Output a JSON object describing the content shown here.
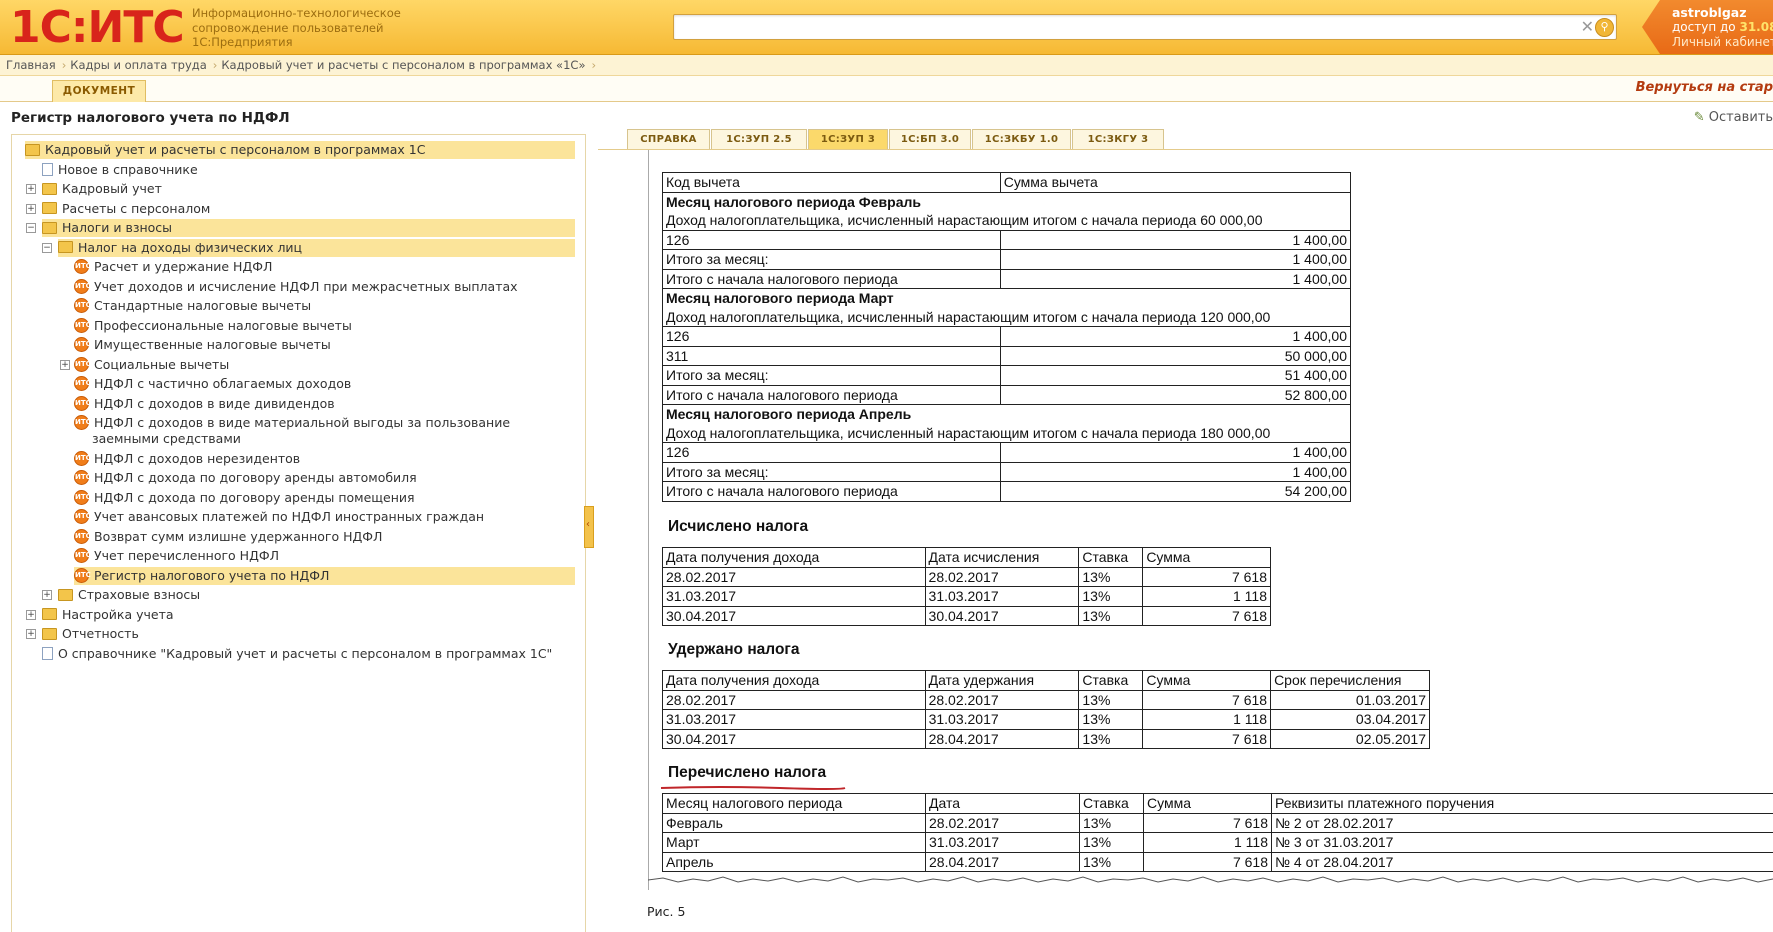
{
  "header": {
    "logo": "1С:ИТС",
    "subtitle_lines": [
      "Информационно-технологическое",
      "сопровождение пользователей",
      "1С:Предприятия"
    ],
    "search_value": "",
    "account_user": "astroblgaz",
    "account_access_prefix": "доступ до",
    "account_access_date": "31.08.",
    "account_cabinet": "Личный кабинет"
  },
  "breadcrumb": [
    "Главная",
    "Кадры и оплата труда",
    "Кадровый учет и расчеты с персоналом в программах «1С»"
  ],
  "doc_tab": "ДОКУМЕНТ",
  "back_link": "Вернуться на стар",
  "page_title": "Регистр налогового учета по НДФЛ",
  "leave_link": "Оставить",
  "tree": [
    {
      "label": "Кадровый учет и расчеты с персоналом в программах 1С",
      "icon": "folder-icon",
      "selected": true
    },
    {
      "label": "Новое в справочнике",
      "icon": "document-icon"
    },
    {
      "label": "Кадровый учет",
      "icon": "folder-icon",
      "toggle": "+"
    },
    {
      "label": "Расчеты с персоналом",
      "icon": "folder-icon",
      "toggle": "+"
    },
    {
      "label": "Налоги и взносы",
      "icon": "folder-icon",
      "toggle": "−",
      "selected": true
    },
    {
      "label": "Налог на доходы физических лиц",
      "icon": "folder-icon",
      "toggle": "−",
      "selected": true
    },
    {
      "label": "Расчет и удержание НДФЛ",
      "icon": "its-badge-icon"
    },
    {
      "label": "Учет доходов и исчисление НДФЛ при межрасчетных выплатах",
      "icon": "its-badge-icon"
    },
    {
      "label": "Стандартные налоговые вычеты",
      "icon": "its-badge-icon"
    },
    {
      "label": "Профессиональные налоговые вычеты",
      "icon": "its-badge-icon"
    },
    {
      "label": "Имущественные налоговые вычеты",
      "icon": "its-badge-icon"
    },
    {
      "label": "Социальные вычеты",
      "icon": "its-badge-icon",
      "toggle": "+"
    },
    {
      "label": "НДФЛ с частично облагаемых доходов",
      "icon": "its-badge-icon"
    },
    {
      "label": "НДФЛ с доходов в виде дивидендов",
      "icon": "its-badge-icon"
    },
    {
      "label": "НДФЛ с доходов в виде материальной выгоды за пользование",
      "label2": "заемными средствами",
      "icon": "its-badge-icon"
    },
    {
      "label": "НДФЛ с доходов нерезидентов",
      "icon": "its-badge-icon"
    },
    {
      "label": "НДФЛ с дохода по договору аренды автомобиля",
      "icon": "its-badge-icon"
    },
    {
      "label": "НДФЛ с дохода по договору аренды помещения",
      "icon": "its-badge-icon"
    },
    {
      "label": "Учет авансовых платежей по НДФЛ иностранных граждан",
      "icon": "its-badge-icon"
    },
    {
      "label": "Возврат сумм излишне удержанного НДФЛ",
      "icon": "its-badge-icon"
    },
    {
      "label": "Учет перечисленного НДФЛ",
      "icon": "its-badge-icon"
    },
    {
      "label": "Регистр налогового учета по НДФЛ",
      "icon": "its-badge-icon",
      "selected": true
    },
    {
      "label": "Страховые взносы",
      "icon": "folder-icon",
      "toggle": "+"
    },
    {
      "label": "Настройка учета",
      "icon": "folder-icon",
      "toggle": "+"
    },
    {
      "label": "Отчетность",
      "icon": "folder-icon",
      "toggle": "+"
    },
    {
      "label": "О справочнике \"Кадровый учет и расчеты с персоналом в программах 1С\"",
      "icon": "document-icon"
    }
  ],
  "tabs": [
    "СПРАВКА",
    "1С:ЗУП 2.5",
    "1С:ЗУП 3",
    "1С:БП 3.0",
    "1С:ЗКБУ 1.0",
    "1С:ЗКГУ 3"
  ],
  "active_tab": "1С:ЗУП 3",
  "deductions": {
    "header": [
      "Код вычета",
      "Сумма вычета"
    ],
    "months": [
      {
        "title": "Месяц налогового периода Февраль",
        "income": "Доход налогоплательщика, исчисленный нарастающим итогом с начала периода 60 000,00",
        "rows": [
          [
            "126",
            "1 400,00"
          ],
          [
            "Итого за месяц:",
            "1 400,00"
          ],
          [
            "Итого с начала налогового периода",
            "1 400,00"
          ]
        ]
      },
      {
        "title": "Месяц налогового периода Март",
        "income": "Доход налогоплательщика, исчисленный нарастающим итогом с начала периода 120 000,00",
        "rows": [
          [
            "126",
            "1 400,00"
          ],
          [
            "311",
            "50 000,00"
          ],
          [
            "Итого за месяц:",
            "51 400,00"
          ],
          [
            "Итого с начала налогового периода",
            "52 800,00"
          ]
        ]
      },
      {
        "title": "Месяц налогового периода Апрель",
        "income": "Доход налогоплательщика, исчисленный нарастающим итогом с начала периода 180 000,00",
        "rows": [
          [
            "126",
            "1 400,00"
          ],
          [
            "Итого за месяц:",
            "1 400,00"
          ],
          [
            "Итого с начала налогового периода",
            "54 200,00"
          ]
        ]
      }
    ]
  },
  "calculated": {
    "title": "Исчислено налога",
    "header": [
      "Дата получения дохода",
      "Дата исчисления",
      "Ставка",
      "Сумма"
    ],
    "rows": [
      [
        "28.02.2017",
        "28.02.2017",
        "13%",
        "7 618"
      ],
      [
        "31.03.2017",
        "31.03.2017",
        "13%",
        "1 118"
      ],
      [
        "30.04.2017",
        "30.04.2017",
        "13%",
        "7 618"
      ]
    ]
  },
  "withheld": {
    "title": "Удержано налога",
    "header": [
      "Дата получения дохода",
      "Дата удержания",
      "Ставка",
      "Сумма",
      "Срок перечисления"
    ],
    "rows": [
      [
        "28.02.2017",
        "28.02.2017",
        "13%",
        "7 618",
        "01.03.2017"
      ],
      [
        "31.03.2017",
        "31.03.2017",
        "13%",
        "1 118",
        "03.04.2017"
      ],
      [
        "30.04.2017",
        "28.04.2017",
        "13%",
        "7 618",
        "02.05.2017"
      ]
    ]
  },
  "transferred": {
    "title": "Перечислено налога",
    "header": [
      "Месяц налогового периода",
      "Дата",
      "Ставка",
      "Сумма",
      "Реквизиты платежного поручения"
    ],
    "rows": [
      [
        "Февраль",
        "28.02.2017",
        "13%",
        "7 618",
        "№ 2 от 28.02.2017"
      ],
      [
        "Март",
        "31.03.2017",
        "13%",
        "1 118",
        "№ 3 от 31.03.2017"
      ],
      [
        "Апрель",
        "28.04.2017",
        "13%",
        "7 618",
        "№ 4 от 28.04.2017"
      ]
    ]
  },
  "caption": "Рис. 5"
}
